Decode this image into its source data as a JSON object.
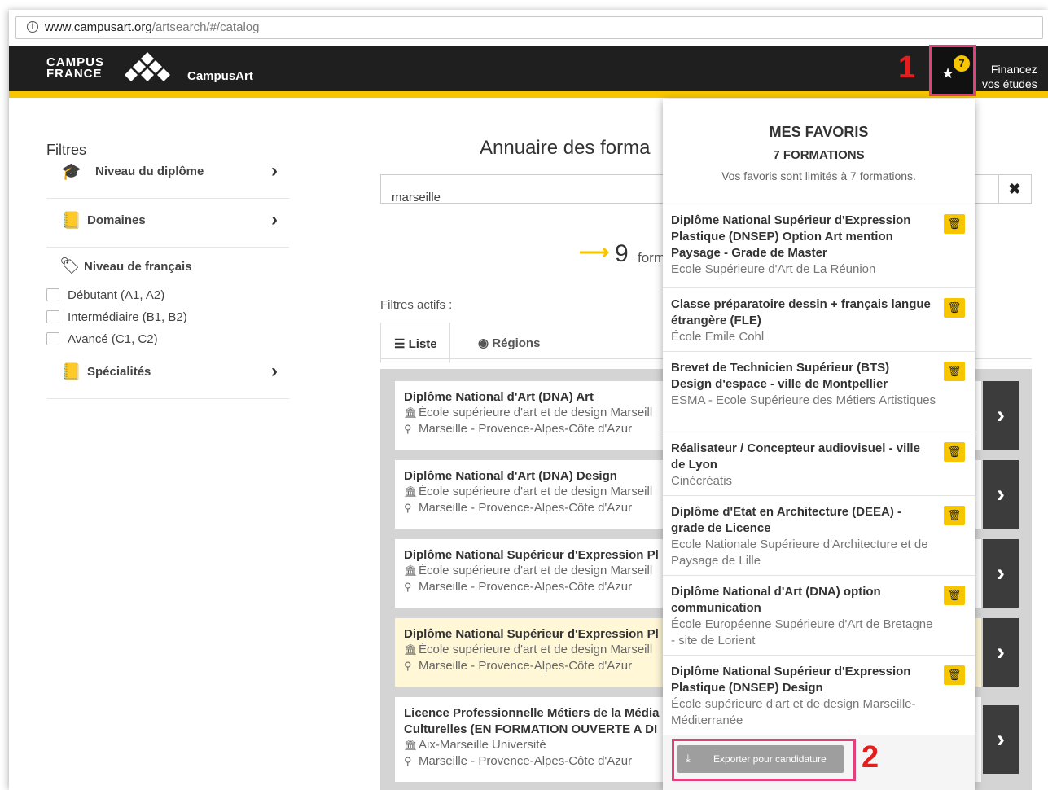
{
  "browser": {
    "url_host": "www.campusart.org",
    "url_path": "/artsearch/#/catalog"
  },
  "header": {
    "logo_line1": "CAMPUS",
    "logo_line2": "FRANCE",
    "app_name": "CampusArt",
    "favorites_count": "7",
    "finance_line1": "Financez",
    "finance_line2": "vos études",
    "annotation_1": "1",
    "annotation_2": "2"
  },
  "filters": {
    "title": "Filtres",
    "niveau_diplome": "Niveau du diplôme",
    "domaines": "Domaines",
    "niveau_francais": "Niveau de français",
    "checkboxes": [
      "Débutant (A1, A2)",
      "Intermédiaire (B1, B2)",
      "Avancé (C1, C2)"
    ],
    "specialites": "Spécialités"
  },
  "main": {
    "heading": "Annuaire des forma",
    "search_value": "marseille",
    "result_count": "9",
    "result_label": "form",
    "active_filters": "Filtres actifs :",
    "tabs": [
      "Liste",
      "Régions"
    ]
  },
  "results": [
    {
      "title": "Diplôme National d'Art (DNA) Art",
      "school": "École supérieure d'art et de design Marseill",
      "location": "Marseille - Provence-Alpes-Côte d'Azur"
    },
    {
      "title": "Diplôme National d'Art (DNA) Design",
      "school": "École supérieure d'art et de design Marseill",
      "location": "Marseille - Provence-Alpes-Côte d'Azur"
    },
    {
      "title": "Diplôme National Supérieur d'Expression Pl",
      "school": "École supérieure d'art et de design Marseill",
      "location": "Marseille - Provence-Alpes-Côte d'Azur"
    },
    {
      "title": "Diplôme National Supérieur d'Expression Pl",
      "school": "École supérieure d'art et de design Marseill",
      "location": "Marseille - Provence-Alpes-Côte d'Azur"
    },
    {
      "title_line1": "Licence Professionnelle Métiers de la Média",
      "title_line2": "Culturelles (EN FORMATION OUVERTE A DI",
      "school": "Aix-Marseille Université",
      "location": "Marseille - Provence-Alpes-Côte d'Azur"
    }
  ],
  "favorites": {
    "title": "MES FAVORIS",
    "subtitle": "7 FORMATIONS",
    "note": "Vos favoris sont limités à 7 formations.",
    "items": [
      {
        "title": "Diplôme National Supérieur d'Expression Plastique (DNSEP) Option Art mention Paysage - Grade de Master",
        "school": "Ecole Supérieure d'Art de La Réunion"
      },
      {
        "title": "Classe préparatoire dessin + français langue étrangère (FLE)",
        "school": "École Emile Cohl"
      },
      {
        "title": "Brevet de Technicien Supérieur (BTS) Design d'espace - ville de Montpellier",
        "school": "ESMA - Ecole Supérieure des Métiers Artistiques"
      },
      {
        "title": "Réalisateur / Concepteur audiovisuel - ville de Lyon",
        "school": "Cinécréatis"
      },
      {
        "title": "Diplôme d'Etat en Architecture (DEEA) - grade de Licence",
        "school": "Ecole Nationale Supérieure d'Architecture et de Paysage de Lille"
      },
      {
        "title": "Diplôme National d'Art (DNA) option communication",
        "school": "École Européenne Supérieure d'Art de Bretagne - site de Lorient"
      },
      {
        "title": "Diplôme National Supérieur d'Expression Plastique (DNSEP) Design",
        "school": "École supérieure d'art et de design Marseille-Méditerranée"
      }
    ],
    "export_label": "Exporter pour candidature"
  },
  "colors": {
    "accent_yellow": "#f7c600",
    "header_dark": "#1f1f1f",
    "annotation_red": "#e41d1d",
    "annotation_pink": "#e0417a"
  }
}
